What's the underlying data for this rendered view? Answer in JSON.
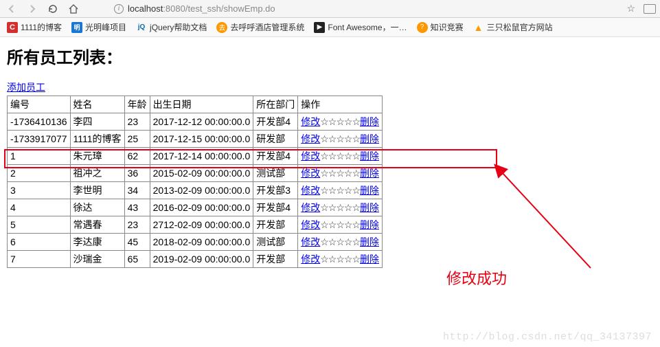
{
  "browser": {
    "url_host": "localhost",
    "url_port": ":8080",
    "url_path": "/test_ssh/showEmp.do"
  },
  "bookmarks": [
    {
      "icon": "red",
      "iconText": "C",
      "label": "1111的博客"
    },
    {
      "icon": "blue",
      "iconText": "明",
      "label": "光明峰项目"
    },
    {
      "icon": "jq",
      "iconText": "jQ",
      "label": "jQuery帮助文档"
    },
    {
      "icon": "orange-circle",
      "iconText": "去",
      "label": "去呼呼酒店管理系统"
    },
    {
      "icon": "dark",
      "iconText": "▶",
      "label": "Font Awesome，一…"
    },
    {
      "icon": "orange-circle",
      "iconText": "?",
      "label": "知识竞赛"
    },
    {
      "icon": "amber",
      "iconText": "▲",
      "label": "三只松鼠官方网站"
    }
  ],
  "page": {
    "title": "所有员工列表：",
    "add_link": "添加员工"
  },
  "table": {
    "headers": [
      "编号",
      "姓名",
      "年龄",
      "出生日期",
      "所在部门",
      "操作"
    ],
    "action_edit": "修改",
    "action_stars": "☆☆☆☆☆",
    "action_delete": "删除",
    "rows": [
      {
        "id": "-1736410136",
        "name": "李四",
        "age": "23",
        "birth": "2017-12-12 00:00:00.0",
        "dept": "开发部4"
      },
      {
        "id": "-1733917077",
        "name": "1111的博客",
        "age": "25",
        "birth": "2017-12-15 00:00:00.0",
        "dept": "研发部"
      },
      {
        "id": "1",
        "name": "朱元璋",
        "age": "62",
        "birth": "2017-12-14 00:00:00.0",
        "dept": "开发部4"
      },
      {
        "id": "2",
        "name": "祖冲之",
        "age": "36",
        "birth": "2015-02-09 00:00:00.0",
        "dept": "测试部"
      },
      {
        "id": "3",
        "name": "李世明",
        "age": "34",
        "birth": "2013-02-09 00:00:00.0",
        "dept": "开发部3"
      },
      {
        "id": "4",
        "name": "徐达",
        "age": "43",
        "birth": "2016-02-09 00:00:00.0",
        "dept": "开发部4"
      },
      {
        "id": "5",
        "name": "常遇春",
        "age": "23",
        "birth": "2712-02-09 00:00:00.0",
        "dept": "开发部"
      },
      {
        "id": "6",
        "name": "李达康",
        "age": "45",
        "birth": "2018-02-09 00:00:00.0",
        "dept": "测试部"
      },
      {
        "id": "7",
        "name": "沙瑞金",
        "age": "65",
        "birth": "2019-02-09 00:00:00.0",
        "dept": "开发部"
      }
    ]
  },
  "annotation": {
    "text": "修改成功"
  },
  "watermark": "http://blog.csdn.net/qq_34137397"
}
